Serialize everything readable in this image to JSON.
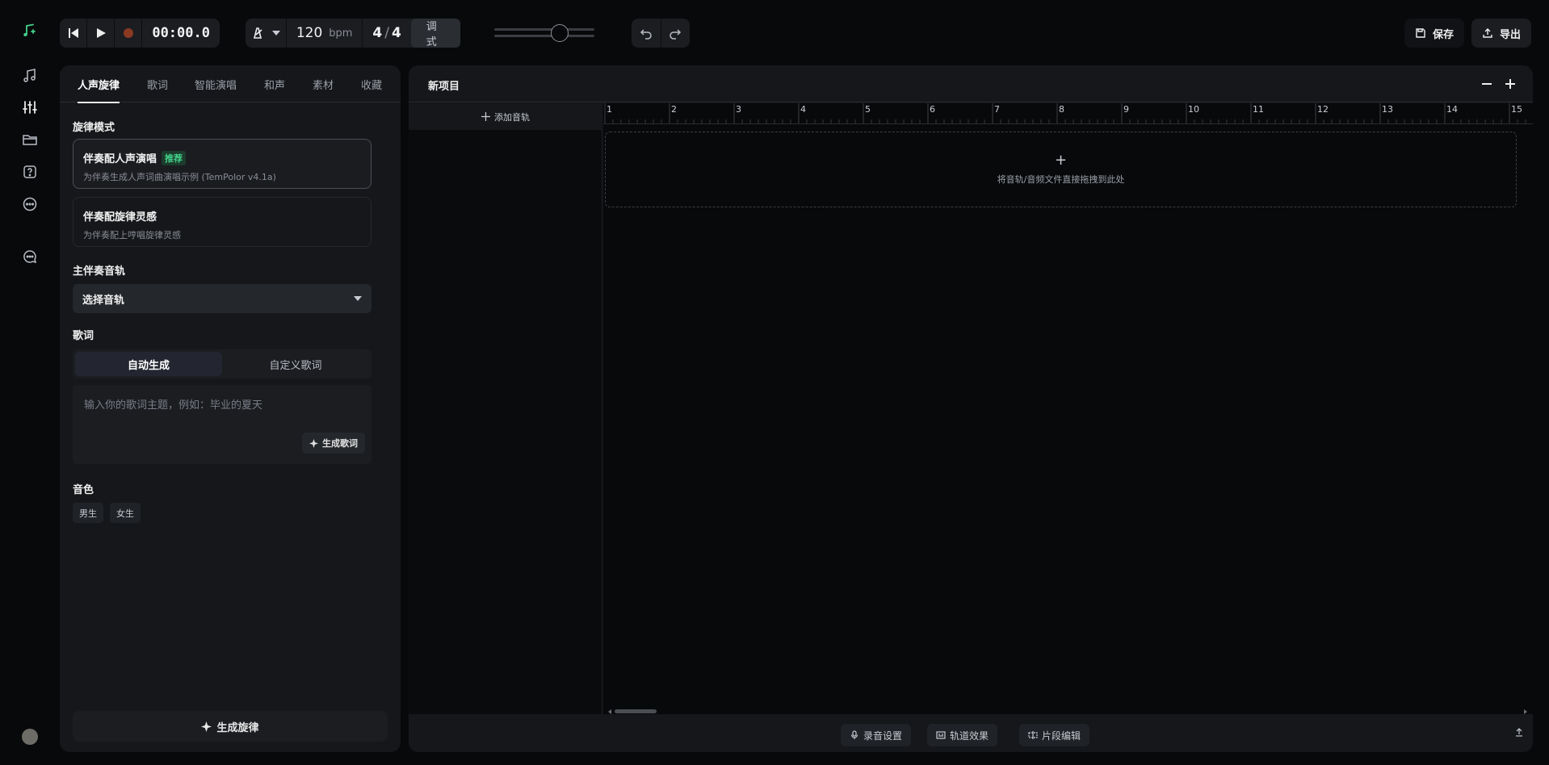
{
  "transport": {
    "time": "00:00.0",
    "bpm": "120",
    "bpm_unit": "bpm",
    "sig_num": "4",
    "sig_den": "4",
    "tune_label": "调式"
  },
  "toolbar": {
    "save_label": "保存",
    "export_label": "导出"
  },
  "left_panel": {
    "tabs": [
      "人声旋律",
      "歌词",
      "智能演唱",
      "和声",
      "素材",
      "收藏"
    ],
    "active_tab": 0,
    "melody_mode_title": "旋律模式",
    "cards": [
      {
        "title": "伴奏配人声演唱",
        "badge": "推荐",
        "desc": "为伴奏生成人声词曲演唱示例 (TemPolor v4.1a)"
      },
      {
        "title": "伴奏配旋律灵感",
        "badge": "",
        "desc": "为伴奏配上哼唱旋律灵感"
      }
    ],
    "main_track_title": "主伴奏音轨",
    "select_value": "选择音轨",
    "lyrics_title": "歌词",
    "lyrics_modes": [
      "自动生成",
      "自定义歌词"
    ],
    "lyrics_placeholder": "输入你的歌词主题，例如：毕业的夏天",
    "gen_lyrics_label": "生成歌词",
    "voice_title": "音色",
    "voices": [
      "男生",
      "女生"
    ],
    "gen_melody_label": "生成旋律"
  },
  "project": {
    "title": "新项目",
    "add_track_label": "添加音轨",
    "bars": [
      "1",
      "2",
      "3",
      "4",
      "5",
      "6",
      "7",
      "8",
      "9",
      "10",
      "11",
      "12",
      "13",
      "14",
      "15"
    ],
    "drop_text": "将音轨/音频文件直接拖拽到此处"
  },
  "footer": {
    "record_label": "录音设置",
    "effects_label": "轨道效果",
    "clip_label": "片段编辑"
  },
  "colors": {
    "accent": "#43d18a",
    "record": "#8a3a22",
    "badge_bg": "#1c3b2c"
  }
}
